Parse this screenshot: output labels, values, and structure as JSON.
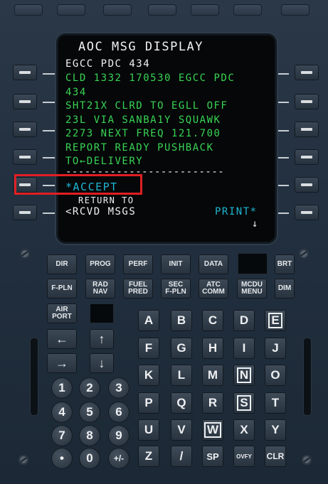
{
  "mcdu": {
    "title": "AOC MSG DISPLAY",
    "lines": [
      {
        "text": "EGCC PDC 434",
        "color": "w"
      },
      {
        "text": "CLD 1332 170530 EGCC PDC",
        "color": "g"
      },
      {
        "text": "434",
        "color": "g"
      },
      {
        "text": "SHT21X CLRD TO EGLL OFF",
        "color": "g"
      },
      {
        "text": "23L VIA SANBA1Y SQUAWK",
        "color": "g"
      },
      {
        "text": "2273 NEXT FREQ 121.700",
        "color": "g"
      },
      {
        "text": "REPORT READY PUSHBACK",
        "color": "g"
      },
      {
        "text": "TO←DELIVERY",
        "color": "g"
      }
    ],
    "separator": "-------------------------",
    "accept": "*ACCEPT",
    "return_small": "RETURN TO",
    "rcvd_msgs": "<RCVD MSGS",
    "print": "PRINT*",
    "down_arrow": "↓"
  },
  "function_keys": [
    {
      "id": "dir",
      "label": "DIR"
    },
    {
      "id": "prog",
      "label": "PROG"
    },
    {
      "id": "perf",
      "label": "PERF"
    },
    {
      "id": "init",
      "label": "INIT"
    },
    {
      "id": "data",
      "label": "DATA"
    },
    {
      "id": "brt",
      "label": "BRT"
    },
    {
      "id": "fpln",
      "label": "F-PLN"
    },
    {
      "id": "radnav",
      "label": "RAD\nNAV"
    },
    {
      "id": "fuelpred",
      "label": "FUEL\nPRED"
    },
    {
      "id": "secfpln",
      "label": "SEC\nF-PLN"
    },
    {
      "id": "atccomm",
      "label": "ATC\nCOMM"
    },
    {
      "id": "mcdumenu",
      "label": "MCDU\nMENU"
    },
    {
      "id": "dim",
      "label": "DIM"
    },
    {
      "id": "airport",
      "label": "AIR\nPORT"
    }
  ],
  "letters": [
    "A",
    "B",
    "C",
    "D",
    "E",
    "F",
    "G",
    "H",
    "I",
    "J",
    "K",
    "L",
    "M",
    "N",
    "O",
    "P",
    "Q",
    "R",
    "S",
    "T",
    "U",
    "V",
    "W",
    "X",
    "Y",
    "Z",
    "/",
    "SP",
    "OVFY",
    "CLR"
  ],
  "digits": [
    "1",
    "2",
    "3",
    "4",
    "5",
    "6",
    "7",
    "8",
    "9",
    "•",
    "0",
    "+/-"
  ],
  "arrows": {
    "left": "←",
    "right": "→",
    "up": "↑",
    "down": "↓"
  }
}
